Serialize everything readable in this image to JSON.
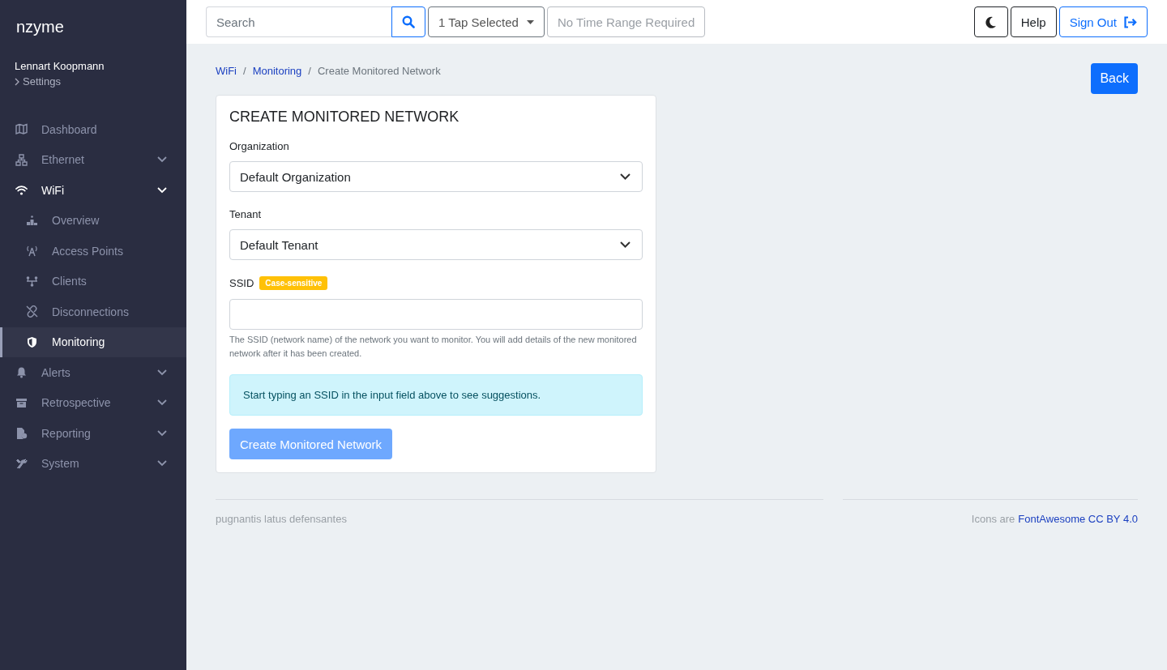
{
  "brand": "nzyme",
  "user": {
    "name": "Lennart Koopmann",
    "settings_link": "Settings"
  },
  "sidebar": {
    "items": [
      {
        "label": "Dashboard",
        "expandable": false,
        "expanded": false
      },
      {
        "label": "Ethernet",
        "expandable": true,
        "expanded": false
      },
      {
        "label": "WiFi",
        "expandable": true,
        "expanded": true,
        "children": [
          {
            "label": "Overview",
            "selected": false
          },
          {
            "label": "Access Points",
            "selected": false
          },
          {
            "label": "Clients",
            "selected": false
          },
          {
            "label": "Disconnections",
            "selected": false
          },
          {
            "label": "Monitoring",
            "selected": true
          }
        ]
      },
      {
        "label": "Alerts",
        "expandable": true,
        "expanded": false
      },
      {
        "label": "Retrospective",
        "expandable": true,
        "expanded": false
      },
      {
        "label": "Reporting",
        "expandable": true,
        "expanded": false
      },
      {
        "label": "System",
        "expandable": true,
        "expanded": false
      }
    ]
  },
  "topbar": {
    "search": {
      "placeholder": "Search"
    },
    "tap_selector": "1 Tap Selected",
    "time_range": "No Time Range Required",
    "help": "Help",
    "sign_out": "Sign Out"
  },
  "breadcrumb": [
    {
      "kind": "link",
      "label": "WiFi"
    },
    {
      "kind": "separator",
      "label": "/"
    },
    {
      "kind": "link",
      "label": "Monitoring"
    },
    {
      "kind": "separator",
      "label": "/"
    },
    {
      "kind": "current",
      "label": "Create Monitored Network"
    }
  ],
  "back_button": "Back",
  "form": {
    "title": "CREATE MONITORED NETWORK",
    "organization": {
      "label": "Organization",
      "value": "Default Organization"
    },
    "tenant": {
      "label": "Tenant",
      "value": "Default Tenant"
    },
    "ssid": {
      "label": "SSID",
      "badge": "Case-sensitive",
      "help": "The SSID (network name) of the network you want to monitor. You will add details of the new monitored network after it has been created."
    },
    "info": "Start typing an SSID in the input field above to see suggestions.",
    "submit": {
      "label": "Create Monitored Network",
      "disabled": true
    }
  },
  "footer": {
    "motto": "pugnantis latus defensantes",
    "credit_prefix": "Icons are",
    "credit_link": "FontAwesome CC BY 4.0"
  }
}
